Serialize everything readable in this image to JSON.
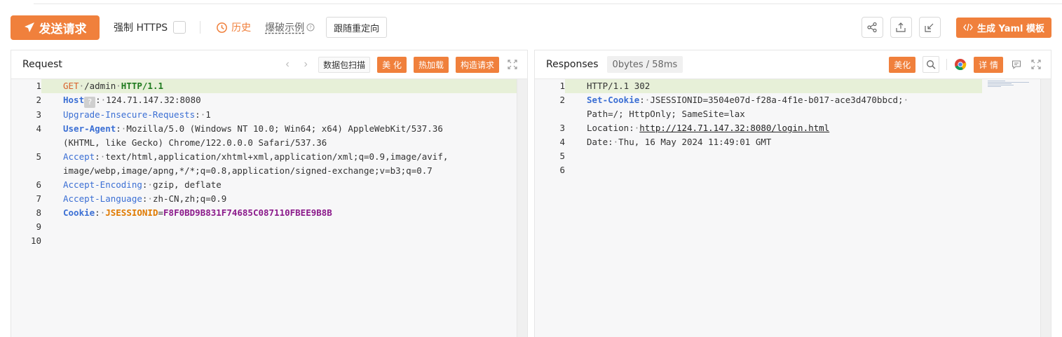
{
  "toolbar": {
    "send_label": "发送请求",
    "force_https_label": "强制 HTTPS",
    "history_label": "历史",
    "examples_label": "爆破示例",
    "redirect_label": "跟随重定向",
    "yaml_label": "生成 Yaml 模板"
  },
  "request": {
    "title": "Request",
    "scan_label": "数据包扫描",
    "beautify_label": "美 化",
    "hotload_label": "热加载",
    "build_label": "构造请求",
    "lines": [
      {
        "n": "1",
        "method": "GET",
        "path": "/admin",
        "version": "HTTP/1.1"
      },
      {
        "n": "2",
        "name": "Host",
        "badge": "?",
        "value": "124.71.147.32:8080"
      },
      {
        "n": "3",
        "name": "Upgrade-Insecure-Requests",
        "value": "1"
      },
      {
        "n": "4",
        "name": "User-Agent",
        "value": "Mozilla/5.0 (Windows NT 10.0; Win64; x64) AppleWebKit/537.36",
        "cont": "(KHTML, like Gecko) Chrome/122.0.0.0 Safari/537.36"
      },
      {
        "n": "5",
        "name": "Accept",
        "value": "text/html,application/xhtml+xml,application/xml;q=0.9,image/avif,",
        "cont": "image/webp,image/apng,*/*;q=0.8,application/signed-exchange;v=b3;q=0.7"
      },
      {
        "n": "6",
        "name": "Accept-Encoding",
        "value": "gzip, deflate"
      },
      {
        "n": "7",
        "name": "Accept-Language",
        "value": "zh-CN,zh;q=0.9"
      },
      {
        "n": "8",
        "name": "Cookie",
        "cookie_key": "JSESSIONID",
        "cookie_val": "F8F0BD9B831F74685C087110FBEE9B8B"
      },
      {
        "n": "9"
      },
      {
        "n": "10"
      }
    ]
  },
  "response": {
    "title": "Responses",
    "size_badge": "0bytes / 58ms",
    "beautify_label": "美化",
    "detail_label": "详 情",
    "lines": [
      {
        "n": "1",
        "text": "HTTP/1.1 302"
      },
      {
        "n": "2",
        "name": "Set-Cookie",
        "value": "JSESSIONID=3504e07d-f28a-4f1e-b017-ace3d470bbcd;",
        "cont": "Path=/; HttpOnly; SameSite=lax"
      },
      {
        "n": "3",
        "plain_name": "Location",
        "link": "http://124.71.147.32:8080/login.html"
      },
      {
        "n": "4",
        "plain_name": "Date",
        "value": "Thu, 16 May 2024 11:49:01 GMT"
      },
      {
        "n": "5"
      },
      {
        "n": "6"
      }
    ]
  },
  "colors": {
    "accent": "#f0803c",
    "header_name": "#3b6fd4",
    "highlight_line": "#e7f0d8"
  }
}
